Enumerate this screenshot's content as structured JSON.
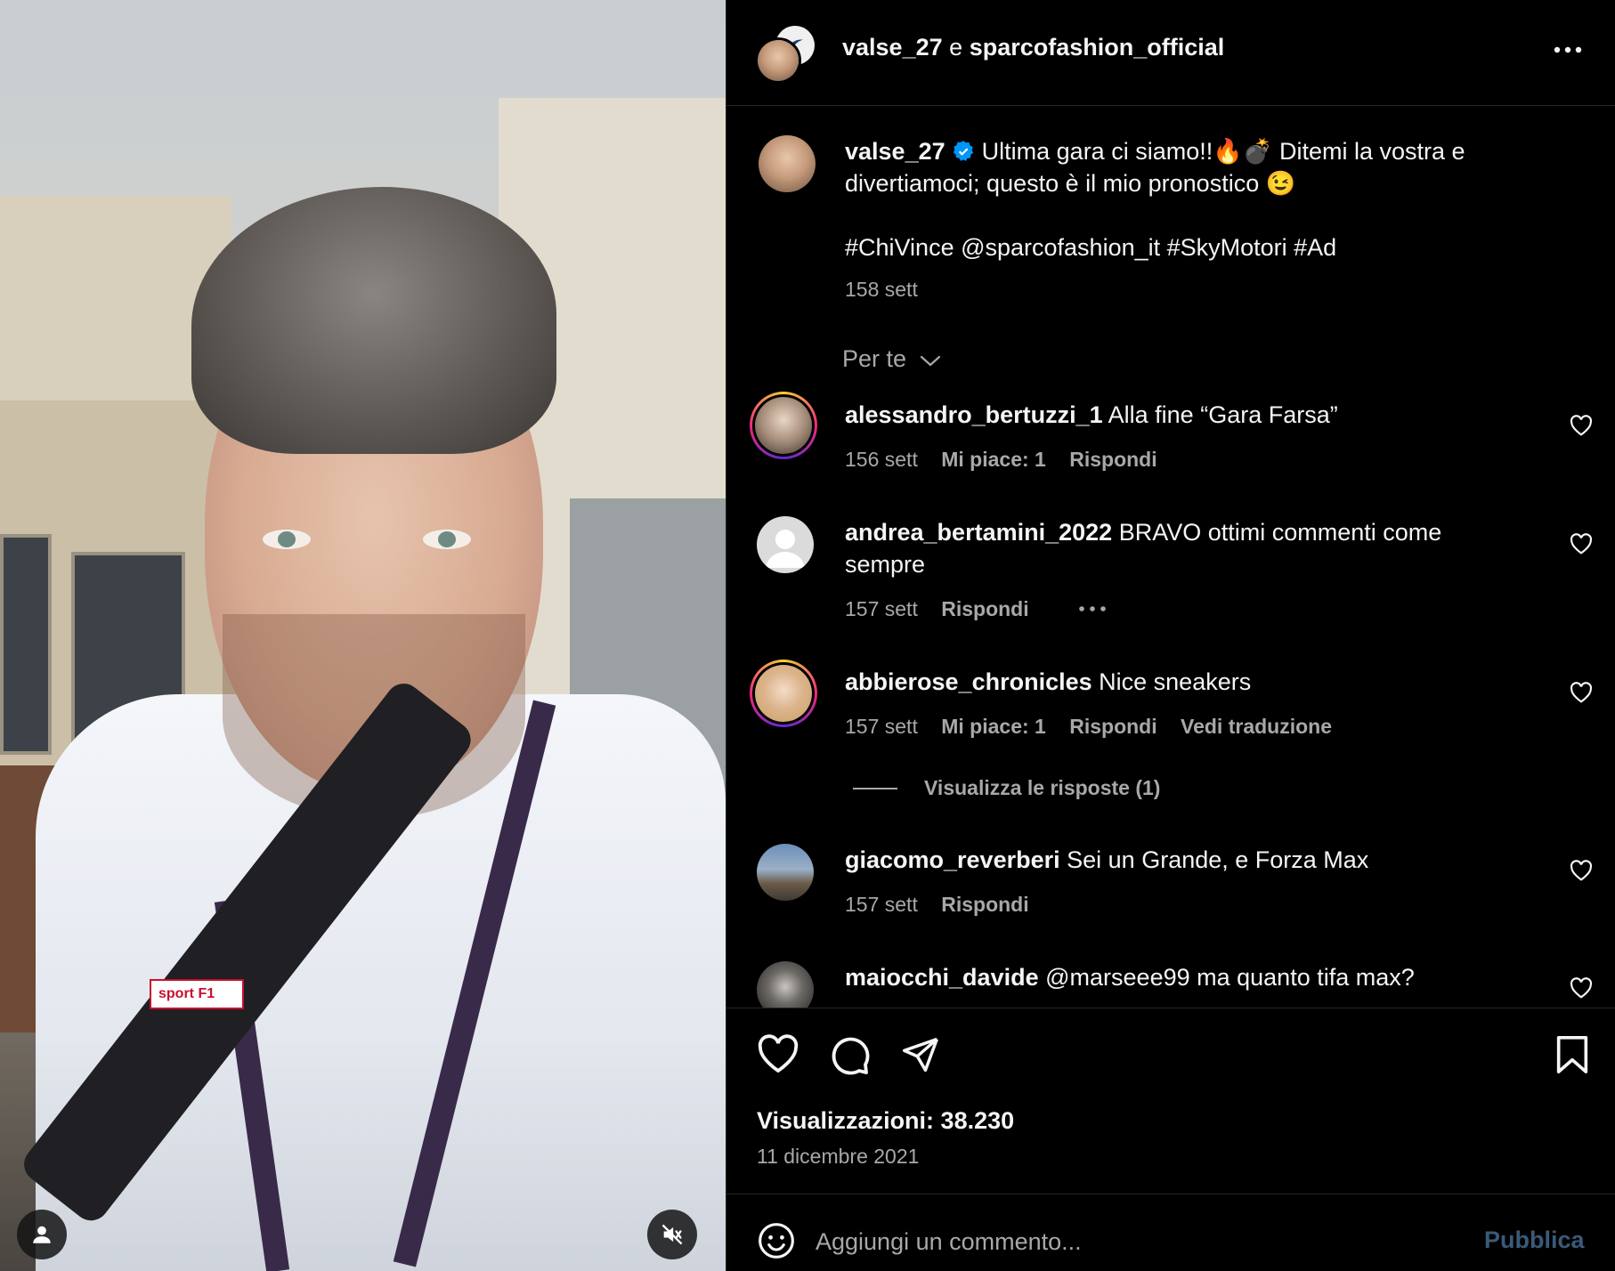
{
  "header": {
    "title_user1": "valse_27",
    "title_sep": "e",
    "title_user2": "sparcofashion_official",
    "more_icon": "more-horizontal-icon"
  },
  "caption": {
    "username": "valse_27",
    "verified_icon": "verified-badge-icon",
    "text_line1": "Ultima gara ci siamo!!🔥💣 Ditemi la vostra e",
    "text_line2": "divertiamoci; questo è il mio pronostico 😉",
    "hashtags": "#ChiVince @sparcofashion_it #SkyMotori #Ad",
    "time": "158 sett"
  },
  "sort": {
    "label": "Per te"
  },
  "comments": [
    {
      "username": "alessandro_bertuzzi_1",
      "text": "Alla fine “Gara Farsa”",
      "text2": "",
      "time": "156 sett",
      "likes": "Mi piace: 1",
      "reply": "Rispondi",
      "translate": ""
    },
    {
      "username": "andrea_bertamini_2022",
      "text": "BRAVO ottimi commenti come",
      "text2": "sempre",
      "time": "157 sett",
      "likes": "",
      "reply": "Rispondi",
      "translate": ""
    },
    {
      "username": "abbierose_chronicles",
      "text": "Nice sneakers",
      "text2": "",
      "time": "157 sett",
      "likes": "Mi piace: 1",
      "reply": "Rispondi",
      "translate": "Vedi traduzione"
    },
    {
      "username": "giacomo_reverberi",
      "text": "Sei un Grande, e Forza Max",
      "text2": "",
      "time": "157 sett",
      "likes": "",
      "reply": "Rispondi",
      "translate": ""
    },
    {
      "username": "maiocchi_davide",
      "text": "@marseee99 ma quanto tifa max?",
      "text2": "",
      "time": "",
      "likes": "",
      "reply": "",
      "translate": ""
    }
  ],
  "view_replies": "Visualizza le risposte (1)",
  "stats": {
    "views": "Visualizzazioni: 38.230",
    "date": "11 dicembre 2021"
  },
  "add_comment": {
    "placeholder": "Aggiungi un commento...",
    "publish": "Pubblica"
  },
  "colors": {
    "verified": "#0095f6",
    "muted": "#a8a8a8",
    "publish": "#3a5a7a"
  }
}
